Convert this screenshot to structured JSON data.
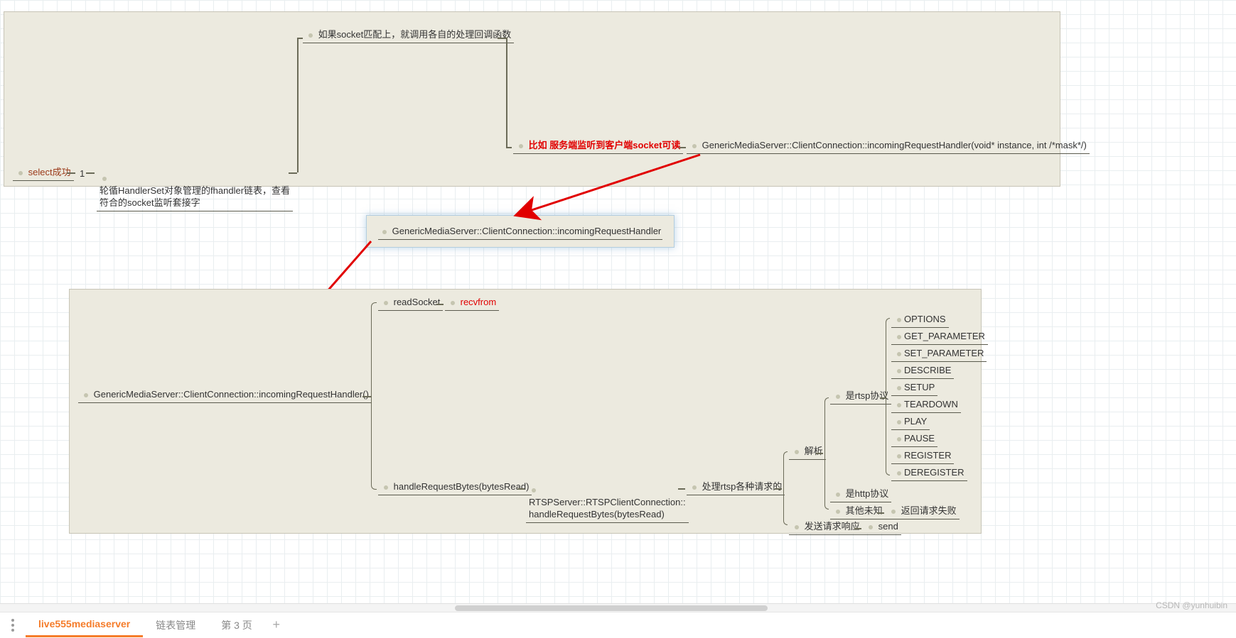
{
  "panel1": {
    "select_success": "select成功",
    "one": "1",
    "loop_handler": "轮循HandlerSet对象管理的fhandler链表，查看\n符合的socket监听套接字",
    "socket_match": "如果socket匹配上，就调用各自的处理回调函数",
    "example_highlight": "比如 服务端监听到客户端socket可读",
    "handler_sig": "GenericMediaServer::ClientConnection::incomingRequestHandler(void* instance, int /*mask*/)"
  },
  "middle": {
    "handler": "GenericMediaServer::ClientConnection::incomingRequestHandler"
  },
  "panel2": {
    "handler_call": "GenericMediaServer::ClientConnection::incomingRequestHandler()",
    "read_socket": "readSocket",
    "recvfrom": "recvfrom",
    "handle_bytes": "handleRequestBytes(bytesRead)",
    "rtsp_handle": "RTSPServer::RTSPClientConnection::\nhandleRequestBytes(bytesRead)",
    "process_rtsp": "处理rtsp各种请求的",
    "parse": "解析",
    "rtsp_proto": "是rtsp协议",
    "http_proto": "是http协议",
    "other_unknown": "其他未知",
    "fail_resp": "返回请求失败",
    "send_resp": "发送请求响应",
    "send": "send",
    "methods": {
      "options": "OPTIONS",
      "get_param": "GET_PARAMETER",
      "set_param": "SET_PARAMETER",
      "describe": "DESCRIBE",
      "setup": "SETUP",
      "teardown": "TEARDOWN",
      "play": "PLAY",
      "pause": "PAUSE",
      "register": "REGISTER",
      "deregister": "DEREGISTER"
    }
  },
  "tabs": {
    "active": "live555mediaserver",
    "tab2": "链表管理",
    "tab3": "第 3 页"
  },
  "watermark": "CSDN @yunhuibin"
}
